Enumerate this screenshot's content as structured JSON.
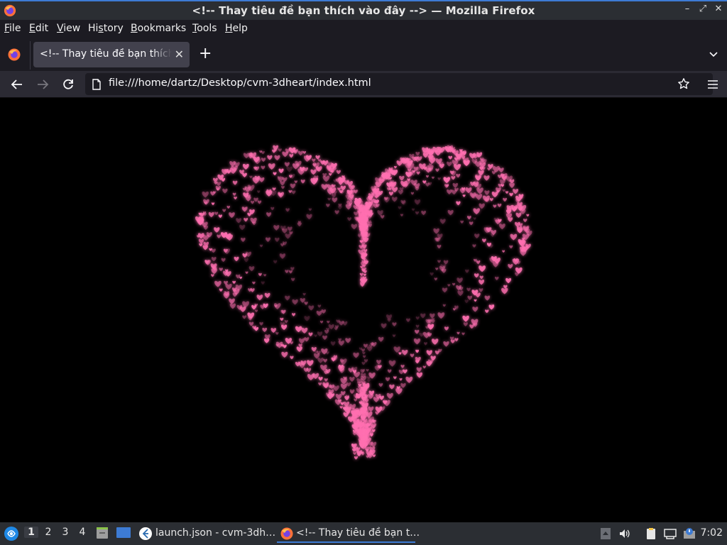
{
  "window": {
    "title": "<!-- Thay tiêu đề bạn thích vào đây --> — Mozilla Firefox",
    "controls": {
      "minimize": "–",
      "maximize": "⤢",
      "close": "✕"
    }
  },
  "menubar": {
    "items": [
      {
        "label": "File",
        "key": "F",
        "rest": "ile"
      },
      {
        "label": "Edit",
        "key": "E",
        "rest": "dit"
      },
      {
        "label": "View",
        "key": "V",
        "rest": "iew"
      },
      {
        "label": "History",
        "key": "s",
        "pre": "Hi",
        "rest": "tory"
      },
      {
        "label": "Bookmarks",
        "key": "B",
        "rest": "ookmarks"
      },
      {
        "label": "Tools",
        "key": "T",
        "rest": "ools"
      },
      {
        "label": "Help",
        "key": "H",
        "rest": "elp"
      }
    ]
  },
  "tabs": [
    {
      "label": "<!-- Thay tiêu đề bạn thích vào đây -->",
      "close": "✕"
    }
  ],
  "tabbar": {
    "new_tab": "+"
  },
  "navbar": {
    "url": "file:///home/dartz/Desktop/cvm-3dheart/index.html"
  },
  "content": {
    "heart_color": "#ff6fb0"
  },
  "taskbar": {
    "workspaces": [
      "1",
      "2",
      "3",
      "4"
    ],
    "active_workspace": "1",
    "apps": [
      {
        "title": "launch.json - cvm-3dh…",
        "icon": "vscode-icon"
      },
      {
        "title": "<!-- Thay tiêu đề bạn t…",
        "icon": "firefox-icon"
      }
    ],
    "clock": "7:02"
  }
}
